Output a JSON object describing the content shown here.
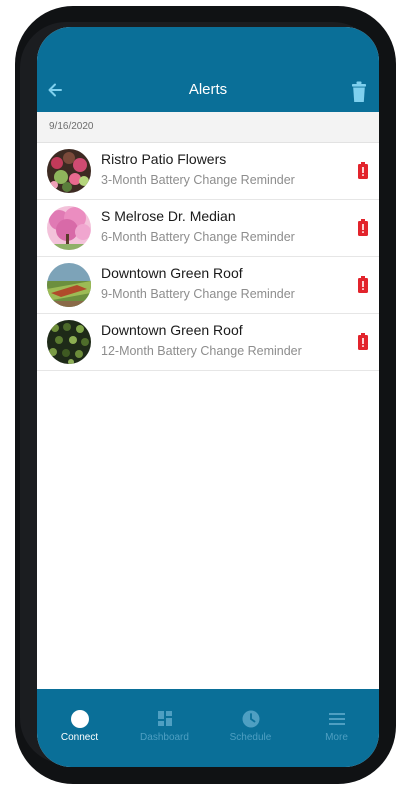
{
  "header": {
    "title": "Alerts",
    "back_icon": "back-arrow-icon",
    "delete_icon": "trash-icon"
  },
  "date_label": "9/16/2020",
  "alerts": [
    {
      "name": "Ristro Patio Flowers",
      "subtitle": "3-Month Battery Change Reminder",
      "avatar": "flowers",
      "status_icon": "battery-low-icon"
    },
    {
      "name": "S Melrose Dr. Median",
      "subtitle": "6-Month Battery Change Reminder",
      "avatar": "pink-tree",
      "status_icon": "battery-low-icon"
    },
    {
      "name": "Downtown Green Roof",
      "subtitle": "9-Month Battery Change Reminder",
      "avatar": "green-roof",
      "status_icon": "battery-low-icon"
    },
    {
      "name": "Downtown Green Roof",
      "subtitle": "12-Month Battery Change Reminder",
      "avatar": "plants",
      "status_icon": "battery-low-icon"
    }
  ],
  "tabs": [
    {
      "label": "Connect",
      "icon": "circle-icon",
      "active": true
    },
    {
      "label": "Dashboard",
      "icon": "dashboard-icon",
      "active": false
    },
    {
      "label": "Schedule",
      "icon": "clock-icon",
      "active": false
    },
    {
      "label": "More",
      "icon": "menu-icon",
      "active": false
    }
  ],
  "colors": {
    "primary": "#0a6f98",
    "alert_red": "#e2242c",
    "inactive_tab": "#4e9fc2"
  }
}
